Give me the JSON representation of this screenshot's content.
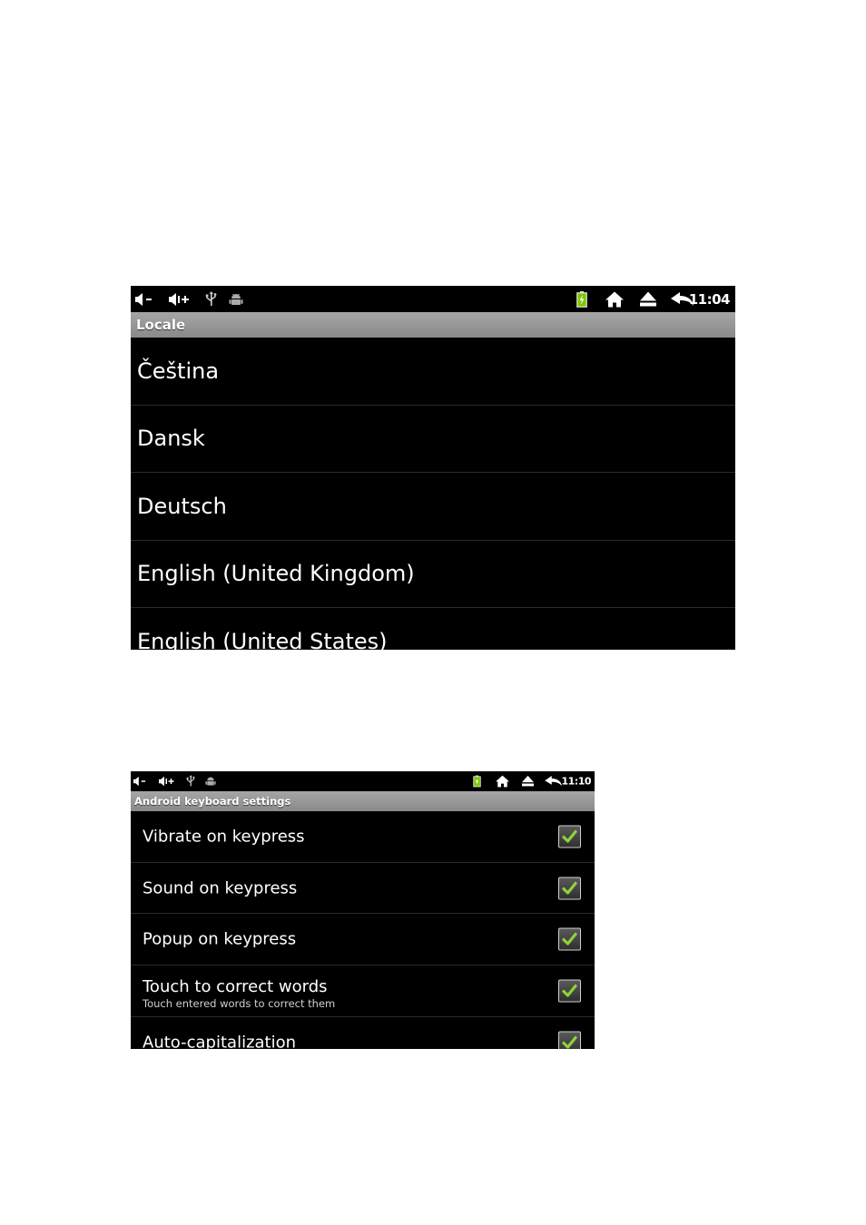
{
  "screens": [
    {
      "status_bar": {
        "icons_left": [
          "volume-down-icon",
          "volume-up-icon",
          "usb-icon",
          "android-debug-icon"
        ],
        "icons_right": [
          "battery-charging-icon",
          "home-icon",
          "eject-icon",
          "back-icon"
        ],
        "time": "11:04"
      },
      "title": "Locale",
      "items": [
        {
          "label": "Čeština"
        },
        {
          "label": "Dansk"
        },
        {
          "label": "Deutsch"
        },
        {
          "label": "English (United Kingdom)"
        },
        {
          "label": "English (United States)"
        }
      ]
    },
    {
      "status_bar": {
        "icons_left": [
          "volume-down-icon",
          "volume-up-icon",
          "usb-icon",
          "android-debug-icon"
        ],
        "icons_right": [
          "battery-charging-icon",
          "home-icon",
          "eject-icon",
          "back-icon"
        ],
        "time": "11:10"
      },
      "title": "Android keyboard settings",
      "items": [
        {
          "label": "Vibrate on keypress",
          "checked": true
        },
        {
          "label": "Sound on keypress",
          "checked": true
        },
        {
          "label": "Popup on keypress",
          "checked": true
        },
        {
          "label": "Touch to correct words",
          "summary": "Touch entered words to correct them",
          "checked": true
        },
        {
          "label": "Auto-capitalization",
          "checked": true
        }
      ]
    }
  ],
  "colors": {
    "background": "#000000",
    "title_bar": "#9a9a9a",
    "check_green": "#8fd13a",
    "battery_green": "#7cc600"
  }
}
